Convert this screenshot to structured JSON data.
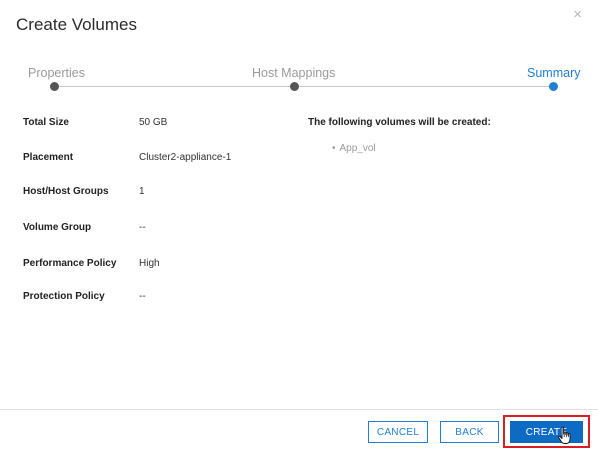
{
  "dialog": {
    "title": "Create Volumes",
    "close_glyph": "×"
  },
  "stepper": {
    "steps": [
      {
        "label": "Properties",
        "state": "done"
      },
      {
        "label": "Host Mappings",
        "state": "done"
      },
      {
        "label": "Summary",
        "state": "active"
      }
    ]
  },
  "summary": {
    "rows": [
      {
        "label": "Total Size",
        "value": "50 GB"
      },
      {
        "label": "Placement",
        "value": "Cluster2-appliance-1"
      },
      {
        "label": "Host/Host Groups",
        "value": "1"
      },
      {
        "label": "Volume Group",
        "value": "--"
      },
      {
        "label": "Performance Policy",
        "value": "High"
      },
      {
        "label": "Protection Policy",
        "value": "--"
      }
    ],
    "created_heading": "The following volumes will be created:",
    "created_items": [
      "App_vol"
    ]
  },
  "footer": {
    "cancel_label": "CANCEL",
    "back_label": "BACK",
    "create_label": "CREATE"
  },
  "colors": {
    "accent": "#1f7fd1",
    "primary_button": "#0e6bc4",
    "highlight": "#d81f26"
  },
  "icons": {
    "close": "close-icon",
    "cursor": "hand-pointer-icon"
  }
}
